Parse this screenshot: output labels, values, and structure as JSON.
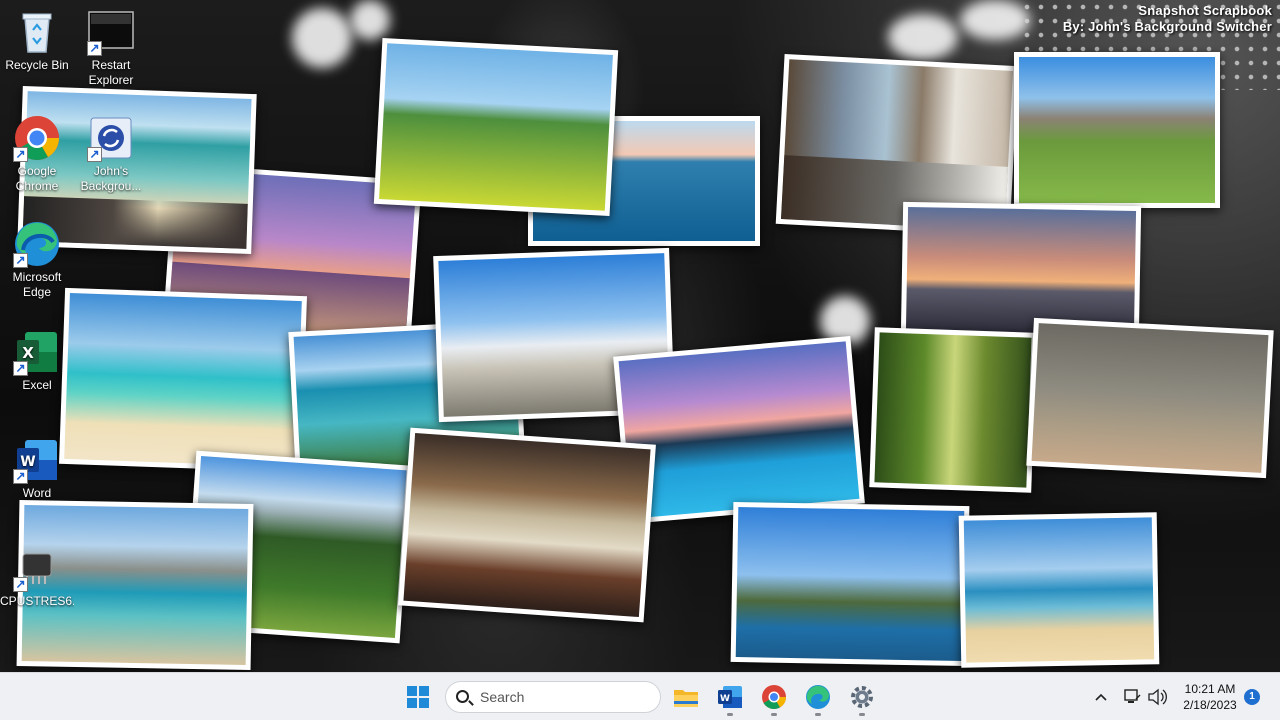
{
  "wallpaper": {
    "title_line1": "Snapshot Scrapbook",
    "title_line2": "By: John's Background Switcher"
  },
  "desktop_icons": [
    {
      "label": "Recycle Bin",
      "icon": "recycle-bin-icon"
    },
    {
      "label": "Restart\nExplorer",
      "icon": "restart-explorer-icon"
    },
    {
      "label": "Google\nChrome",
      "icon": "chrome-icon"
    },
    {
      "label": "John's\nBackgrou...",
      "icon": "johns-background-switcher-icon"
    },
    {
      "label": "Microsoft\nEdge",
      "icon": "edge-icon"
    },
    {
      "label": "Excel",
      "icon": "excel-icon"
    },
    {
      "label": "Word",
      "icon": "word-icon"
    },
    {
      "label": "CPUSTRES6...",
      "icon": "chip-icon"
    }
  ],
  "taskbar": {
    "search_placeholder": "Search",
    "pinned": [
      "start-icon",
      "file-explorer-icon",
      "word-icon",
      "chrome-icon",
      "edge-icon",
      "settings-icon"
    ],
    "tray_icons": [
      "chevron-up-icon",
      "network-icon",
      "volume-icon"
    ],
    "time": "10:21 AM",
    "date": "2/18/2023",
    "notification_count": "1"
  },
  "colors": {
    "taskbar_bg": "#eef0f4",
    "accent": "#1f6fd1",
    "excel_green": "#107c41",
    "word_blue": "#185abd"
  }
}
